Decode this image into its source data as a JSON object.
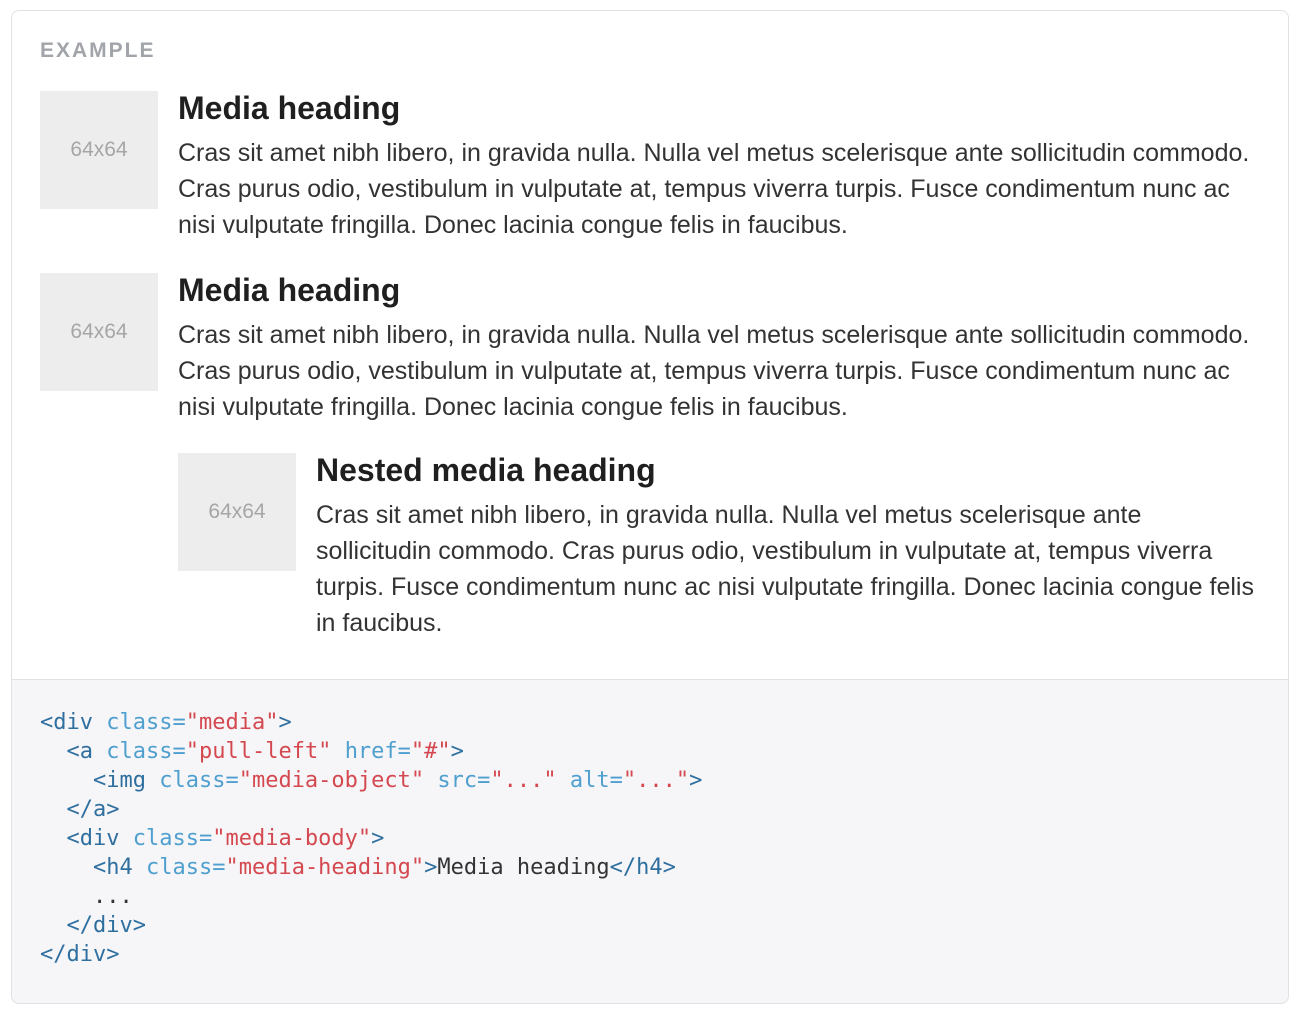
{
  "example": {
    "label": "EXAMPLE",
    "media_items": [
      {
        "placeholder": "64x64",
        "heading": "Media heading",
        "body": "Cras sit amet nibh libero, in gravida nulla. Nulla vel metus scelerisque ante sollicitudin commodo. Cras purus odio, vestibulum in vulputate at, tempus viverra turpis. Fusce condimentum nunc ac nisi vulputate fringilla. Donec lacinia congue felis in faucibus."
      },
      {
        "placeholder": "64x64",
        "heading": "Media heading",
        "body": "Cras sit amet nibh libero, in gravida nulla. Nulla vel metus scelerisque ante sollicitudin commodo. Cras purus odio, vestibulum in vulputate at, tempus viverra turpis. Fusce condimentum nunc ac nisi vulputate fringilla. Donec lacinia congue felis in faucibus.",
        "nested": {
          "placeholder": "64x64",
          "heading": "Nested media heading",
          "body": "Cras sit amet nibh libero, in gravida nulla. Nulla vel metus scelerisque ante sollicitudin commodo. Cras purus odio, vestibulum in vulputate at, tempus viverra turpis. Fusce condimentum nunc ac nisi vulputate fringilla. Donec lacinia congue felis in faucibus."
        }
      }
    ]
  },
  "code_block": {
    "lines": [
      [
        {
          "c": "t",
          "t": "<div"
        },
        {
          "c": "x",
          "t": " "
        },
        {
          "c": "a",
          "t": "class="
        },
        {
          "c": "v",
          "t": "\"media\""
        },
        {
          "c": "t",
          "t": ">"
        }
      ],
      [
        {
          "c": "x",
          "t": "  "
        },
        {
          "c": "t",
          "t": "<a"
        },
        {
          "c": "x",
          "t": " "
        },
        {
          "c": "a",
          "t": "class="
        },
        {
          "c": "v",
          "t": "\"pull-left\""
        },
        {
          "c": "x",
          "t": " "
        },
        {
          "c": "a",
          "t": "href="
        },
        {
          "c": "v",
          "t": "\"#\""
        },
        {
          "c": "t",
          "t": ">"
        }
      ],
      [
        {
          "c": "x",
          "t": "    "
        },
        {
          "c": "t",
          "t": "<img"
        },
        {
          "c": "x",
          "t": " "
        },
        {
          "c": "a",
          "t": "class="
        },
        {
          "c": "v",
          "t": "\"media-object\""
        },
        {
          "c": "x",
          "t": " "
        },
        {
          "c": "a",
          "t": "src="
        },
        {
          "c": "v",
          "t": "\"...\""
        },
        {
          "c": "x",
          "t": " "
        },
        {
          "c": "a",
          "t": "alt="
        },
        {
          "c": "v",
          "t": "\"...\""
        },
        {
          "c": "t",
          "t": ">"
        }
      ],
      [
        {
          "c": "x",
          "t": "  "
        },
        {
          "c": "t",
          "t": "</a>"
        }
      ],
      [
        {
          "c": "x",
          "t": "  "
        },
        {
          "c": "t",
          "t": "<div"
        },
        {
          "c": "x",
          "t": " "
        },
        {
          "c": "a",
          "t": "class="
        },
        {
          "c": "v",
          "t": "\"media-body\""
        },
        {
          "c": "t",
          "t": ">"
        }
      ],
      [
        {
          "c": "x",
          "t": "    "
        },
        {
          "c": "t",
          "t": "<h4"
        },
        {
          "c": "x",
          "t": " "
        },
        {
          "c": "a",
          "t": "class="
        },
        {
          "c": "v",
          "t": "\"media-heading\""
        },
        {
          "c": "t",
          "t": ">"
        },
        {
          "c": "x",
          "t": "Media heading"
        },
        {
          "c": "t",
          "t": "</h4>"
        }
      ],
      [
        {
          "c": "x",
          "t": "    ..."
        }
      ],
      [
        {
          "c": "x",
          "t": "  "
        },
        {
          "c": "t",
          "t": "</div>"
        }
      ],
      [
        {
          "c": "t",
          "t": "</div>"
        }
      ]
    ]
  },
  "colors": {
    "code_tag": "#2f6f9f",
    "code_attr": "#4f9fcf",
    "code_value": "#d44950",
    "code_text": "#333333",
    "code_bg": "#f6f6f8",
    "border": "#e2e2e6",
    "example_label": "#a1a4a8",
    "placeholder_bg": "#ededed",
    "placeholder_fg": "#a6a6a6"
  }
}
